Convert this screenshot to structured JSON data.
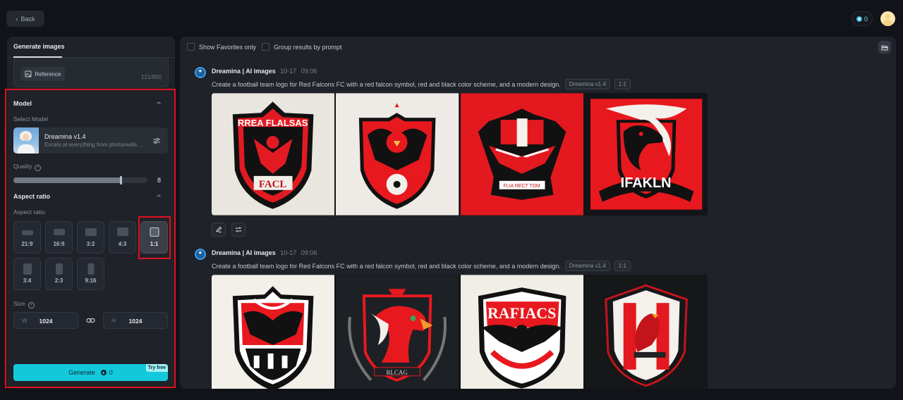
{
  "topbar": {
    "back_label": "Back",
    "credits": "0"
  },
  "left_panel": {
    "tab_label": "Generate images",
    "reference_label": "Reference",
    "char_count": "121/800",
    "model_section": {
      "title": "Model",
      "select_label": "Select Model",
      "model_name": "Dreamina v1.4",
      "model_desc": "Excels at everything from photorealism to painting...",
      "quality_label": "Quality",
      "quality_value": "8",
      "quality_fraction": 0.8
    },
    "aspect_section": {
      "title": "Aspect ratio",
      "sub_label": "Aspect ratio",
      "ratios": [
        {
          "label": "21:9",
          "selected": false
        },
        {
          "label": "16:9",
          "selected": false
        },
        {
          "label": "3:2",
          "selected": false
        },
        {
          "label": "4:3",
          "selected": false
        },
        {
          "label": "1:1",
          "selected": true
        },
        {
          "label": "3:4",
          "selected": false
        },
        {
          "label": "2:3",
          "selected": false
        },
        {
          "label": "9:16",
          "selected": false
        }
      ]
    },
    "size_section": {
      "label": "Size",
      "width_prefix": "W",
      "width_value": "1024",
      "height_prefix": "H",
      "height_value": "1024"
    },
    "generate": {
      "label": "Generate",
      "cost": "0",
      "badge": "Try free"
    }
  },
  "main_panel": {
    "filters": {
      "favorites_label": "Show Favorites only",
      "group_label": "Group results by prompt"
    },
    "generations": [
      {
        "source": "Dreamina | AI images",
        "date": "10-17",
        "time": "09:06",
        "prompt": "Create a football team logo for Red Falcons FC with a red falcon symbol, red and black color scheme, and a modern design.",
        "model_tag": "Dreamina v1.4",
        "ratio_tag": "1:1",
        "images": [
          {
            "alt": "Shield logo with red falcon, text 'RREA FLALSAS' and 'FACL'"
          },
          {
            "alt": "Red shield with black and red eagle holding a football"
          },
          {
            "alt": "Black crest with red falcon on red background"
          },
          {
            "alt": "Red square logo with black falcon head and 'IFAKLN' banner"
          }
        ]
      },
      {
        "source": "Dreamina | AI images",
        "date": "10-17",
        "time": "09:06",
        "prompt": "Create a football team logo for Red Falcons FC with a red falcon symbol, red and black color scheme, and a modern design.",
        "model_tag": "Dreamina v1.4",
        "ratio_tag": "1:1",
        "images": [
          {
            "alt": "Red and black shield with double-headed eagle"
          },
          {
            "alt": "Dark crest with red falcon head and 'RLCAG' text"
          },
          {
            "alt": "Shield with 'RAFIACS' text and black eagle"
          },
          {
            "alt": "White and red shield with perched red falcon"
          }
        ]
      }
    ]
  }
}
